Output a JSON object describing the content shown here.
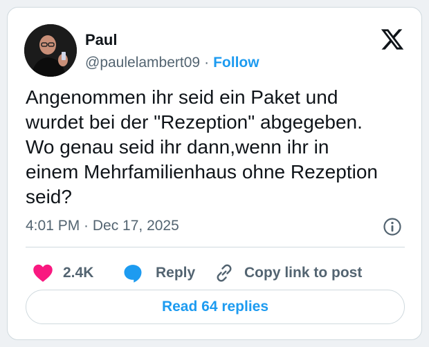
{
  "author": {
    "name": "Paul",
    "handle": "@paulelambert09",
    "separator": "·",
    "follow_label": "Follow",
    "avatar_icon": "profile-photo"
  },
  "platform_icon": "x-logo-icon",
  "tweet": {
    "lines": [
      "Angenommen ihr seid ein Paket und",
      "wurdet bei der \"Rezeption\" abgegeben.",
      "Wo genau seid ihr dann,wenn ihr in",
      "einem Mehrfamilienhaus ohne Rezeption",
      "seid?"
    ]
  },
  "timestamp": "4:01 PM · Dec 17, 2025",
  "info_icon": "info-icon",
  "actions": {
    "likes_count": "2.4K",
    "reply_label": "Reply",
    "copy_link_label": "Copy link to post"
  },
  "read_replies_label": "Read 64 replies",
  "colors": {
    "accent": "#1d9bf0",
    "like": "#f91880",
    "text": "#0f1419",
    "muted": "#536471",
    "border": "#cfd9de"
  }
}
